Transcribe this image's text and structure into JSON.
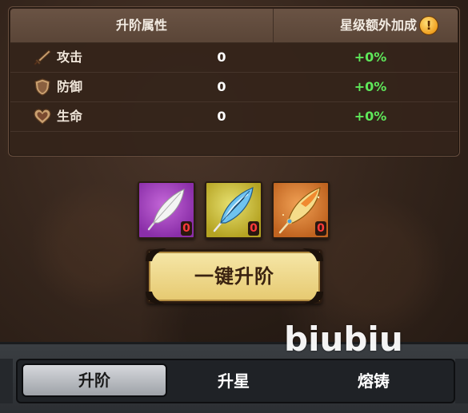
{
  "stats_panel": {
    "header_left": "升阶属性",
    "header_right": "星级额外加成",
    "info_icon": "!",
    "rows": [
      {
        "icon": "sword-icon",
        "label": "攻击",
        "value": "0",
        "bonus": "+0%"
      },
      {
        "icon": "shield-icon",
        "label": "防御",
        "value": "0",
        "bonus": "+0%"
      },
      {
        "icon": "heart-icon",
        "label": "生命",
        "value": "0",
        "bonus": "+0%"
      }
    ]
  },
  "materials": [
    {
      "icon": "white-feather-icon",
      "color": "#8a2ea8",
      "count": "0"
    },
    {
      "icon": "blue-feather-icon",
      "color": "#b5a322",
      "count": "0"
    },
    {
      "icon": "golden-feather-icon",
      "color": "#c06420",
      "count": "0"
    }
  ],
  "upgrade_button": {
    "label": "一键升阶"
  },
  "watermark": "biubiu",
  "tabs": [
    {
      "label": "升阶",
      "active": true
    },
    {
      "label": "升星",
      "active": false
    },
    {
      "label": "熔铸",
      "active": false
    }
  ],
  "colors": {
    "bonus_green": "#5ee85a",
    "count_red": "#ff3a3a",
    "button_gold": "#e6c970"
  }
}
